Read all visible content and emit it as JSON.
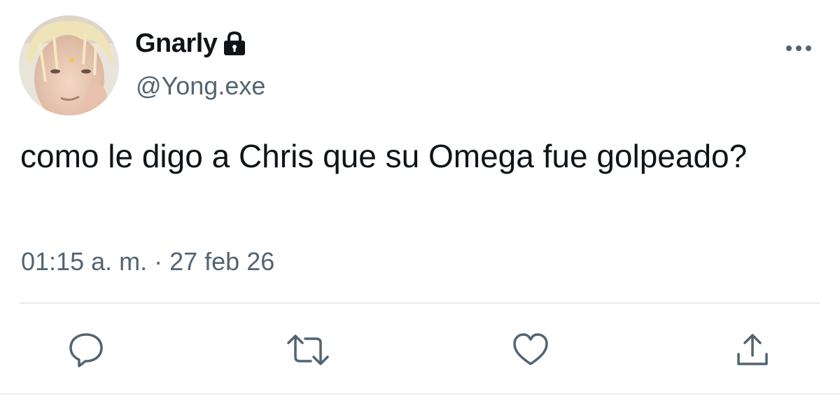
{
  "user": {
    "display_name": "Gnarly",
    "handle": "@Yong.exe",
    "avatar_icon": "profile-photo",
    "protected_icon": "lock-icon"
  },
  "tweet": {
    "text": "como le digo a Chris que su Omega fue golpeado?",
    "time": "01:15 a. m.",
    "separator": "·",
    "date": "27 feb 26"
  },
  "actions": [
    {
      "name": "reply",
      "icon": "speech-bubble-icon"
    },
    {
      "name": "retweet",
      "icon": "retweet-icon"
    },
    {
      "name": "like",
      "icon": "heart-icon"
    },
    {
      "name": "share",
      "icon": "share-icon"
    }
  ],
  "colors": {
    "text_primary": "#0f1419",
    "text_secondary": "#536471",
    "divider": "#e6ecf0"
  }
}
